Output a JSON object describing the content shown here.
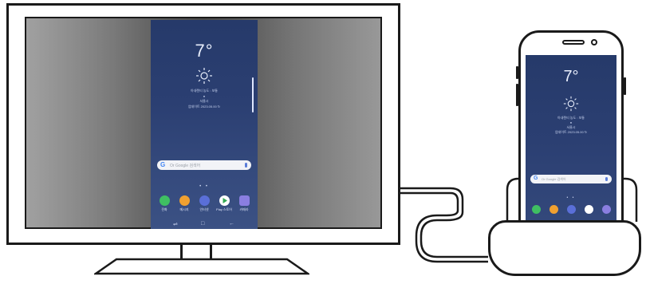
{
  "monitor": {
    "mirror": {
      "time": "7°",
      "info_line_1": "아내렌티 농도 : 보통",
      "info_line_2": "●",
      "info_line_3": "서울시",
      "info_line_4": "업데이트 2023.05.00 ↻",
      "search_placeholder": "Or Google 검색어",
      "page_dots": "• •",
      "apps": [
        "전화",
        "메시지",
        "인터넷",
        "Play 스토어",
        "카메라"
      ],
      "nav": {
        "recent": "⇌",
        "home": "□",
        "back": "←"
      }
    }
  },
  "phone": {
    "time": "7°",
    "info_line_1": "아내렌티 농도 : 보통",
    "info_line_2": "●",
    "info_line_3": "서울시",
    "info_line_4": "업데이트 2023.05.00 ↻",
    "search_placeholder": "Or Google 검색어",
    "page_dots": "• •"
  },
  "colors": {
    "outline": "#1a1a1a",
    "wallpaper_top": "#263a6a",
    "wallpaper_bottom": "#3b5184",
    "app_phone": "#3fbf62",
    "app_message": "#f0a030",
    "app_internet": "#5a6fd8",
    "app_play": "#ffffff",
    "app_camera": "#8a7ee0"
  }
}
